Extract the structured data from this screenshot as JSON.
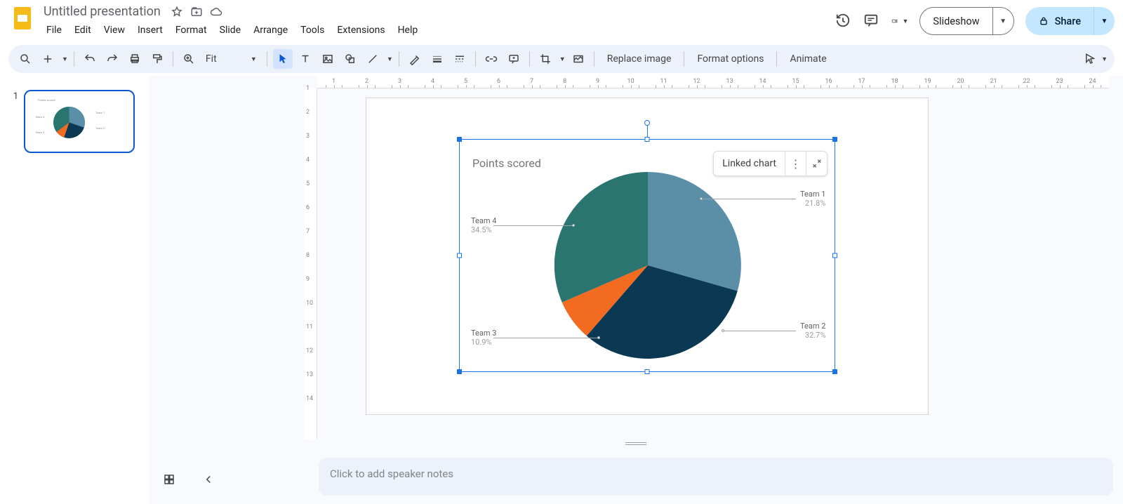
{
  "doc": {
    "title": "Untitled presentation"
  },
  "menu": {
    "file": "File",
    "edit": "Edit",
    "view": "View",
    "insert": "Insert",
    "format": "Format",
    "slide": "Slide",
    "arrange": "Arrange",
    "tools": "Tools",
    "extensions": "Extensions",
    "help": "Help"
  },
  "header": {
    "slideshow": "Slideshow",
    "share": "Share"
  },
  "toolbar": {
    "zoom": "Fit",
    "replace_image": "Replace image",
    "format_options": "Format options",
    "animate": "Animate"
  },
  "slide": {
    "number": "1"
  },
  "linked_chart": {
    "label": "Linked chart"
  },
  "speaker_notes": {
    "placeholder": "Click to add speaker notes"
  },
  "chart_data": {
    "type": "pie",
    "title": "Points scored",
    "series": [
      {
        "name": "Team 1",
        "value": 21.8,
        "pct": "21.8%",
        "color": "#5b8fa8"
      },
      {
        "name": "Team 2",
        "value": 32.7,
        "pct": "32.7%",
        "color": "#0b3954"
      },
      {
        "name": "Team 3",
        "value": 10.9,
        "pct": "10.9%",
        "color": "#f26b21"
      },
      {
        "name": "Team 4",
        "value": 34.5,
        "pct": "34.5%",
        "color": "#2a7570"
      }
    ]
  },
  "labels": {
    "t1": "Team 1",
    "t1p": "21.8%",
    "t2": "Team 2",
    "t2p": "32.7%",
    "t3": "Team 3",
    "t3p": "10.9%",
    "t4": "Team 4",
    "t4p": "34.5%"
  }
}
